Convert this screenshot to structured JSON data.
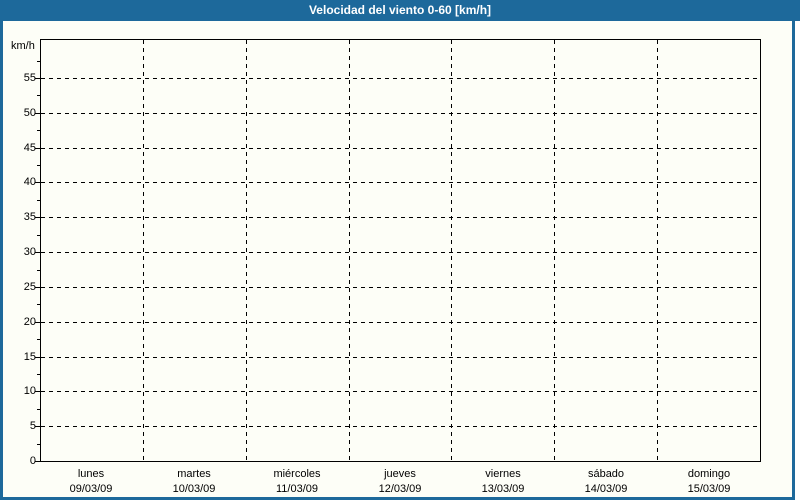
{
  "title": "Velocidad del viento 0-60 [km/h]",
  "colors": {
    "frame_blue": "#1d699b",
    "title_text": "#ffffff",
    "background": "#fdfef7",
    "grid": "#000000",
    "text": "#000000"
  },
  "chart_data": {
    "type": "line",
    "title": "Velocidad del viento 0-60 [km/h]",
    "xlabel": "",
    "ylabel": "km/h",
    "ylim": [
      0,
      60
    ],
    "yticks": [
      0,
      5,
      10,
      15,
      20,
      25,
      30,
      35,
      40,
      45,
      50,
      55
    ],
    "y_minor_tick_step": 2.5,
    "grid": true,
    "legend_position": "none",
    "x_categories": [
      {
        "day": "lunes",
        "date": "09/03/09"
      },
      {
        "day": "martes",
        "date": "10/03/09"
      },
      {
        "day": "miércoles",
        "date": "11/03/09"
      },
      {
        "day": "jueves",
        "date": "12/03/09"
      },
      {
        "day": "viernes",
        "date": "13/03/09"
      },
      {
        "day": "sábado",
        "date": "14/03/09"
      },
      {
        "day": "domingo",
        "date": "15/03/09"
      }
    ],
    "series": []
  }
}
